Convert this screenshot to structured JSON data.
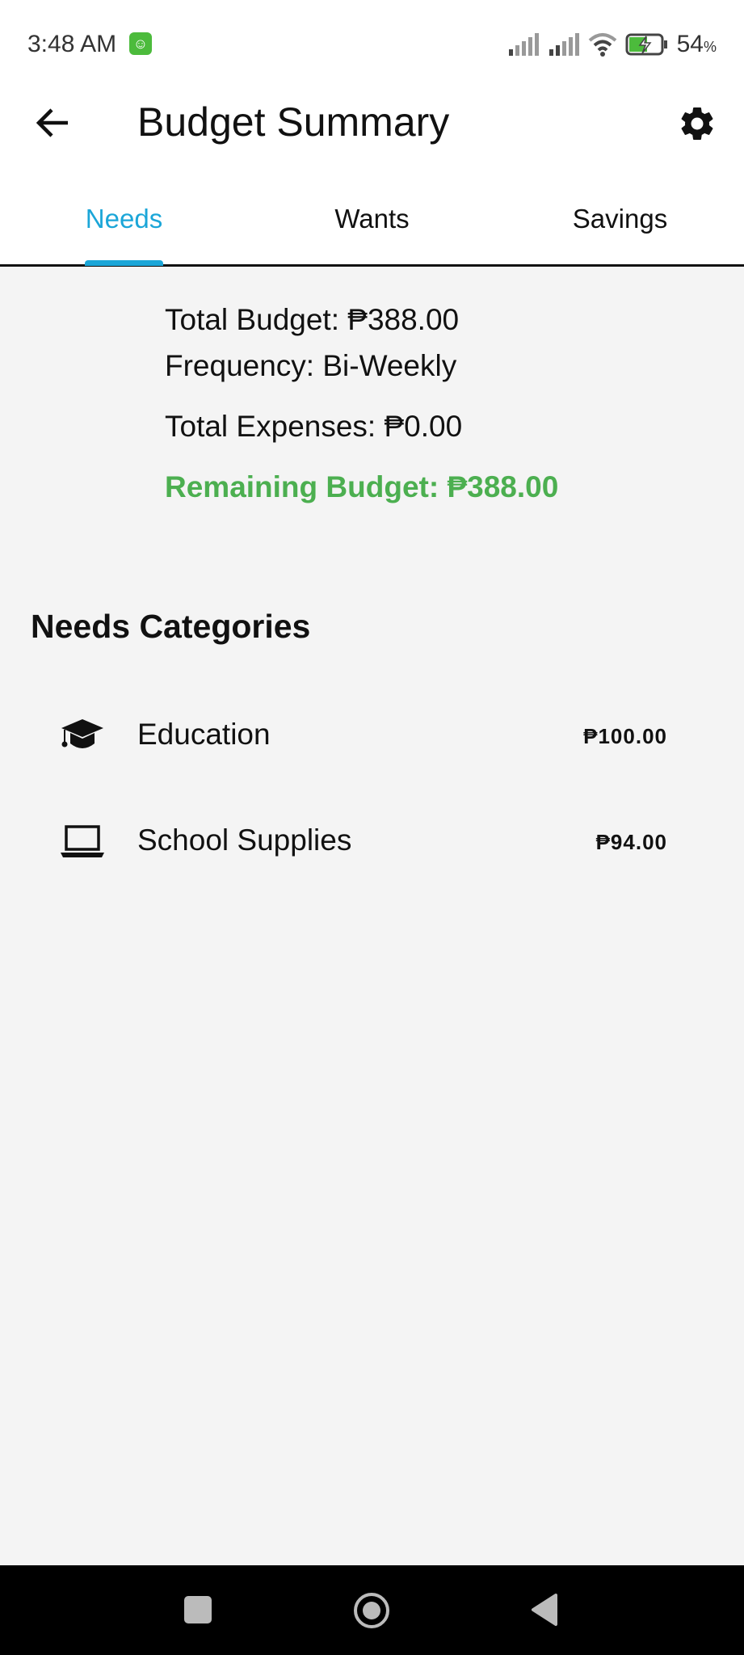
{
  "status_bar": {
    "time": "3:48 AM",
    "battery": "54",
    "battery_unit": "%"
  },
  "app_bar": {
    "title": "Budget Summary"
  },
  "tabs": [
    {
      "label": "Needs",
      "active": true
    },
    {
      "label": "Wants"
    },
    {
      "label": "Savings"
    }
  ],
  "summary": {
    "total_budget": "Total Budget: ₱388.00",
    "frequency": "Frequency: Bi-Weekly",
    "total_expenses": "Total Expenses: ₱0.00",
    "remaining": "Remaining Budget: ₱388.00"
  },
  "categories": {
    "title": "Needs Categories",
    "items": [
      {
        "icon": "graduation-cap-icon",
        "label": "Education",
        "amount": "₱100.00"
      },
      {
        "icon": "laptop-icon",
        "label": "School Supplies",
        "amount": "₱94.00"
      }
    ]
  },
  "colors": {
    "accent": "#1ba6d8",
    "remaining": "#4caf50"
  }
}
